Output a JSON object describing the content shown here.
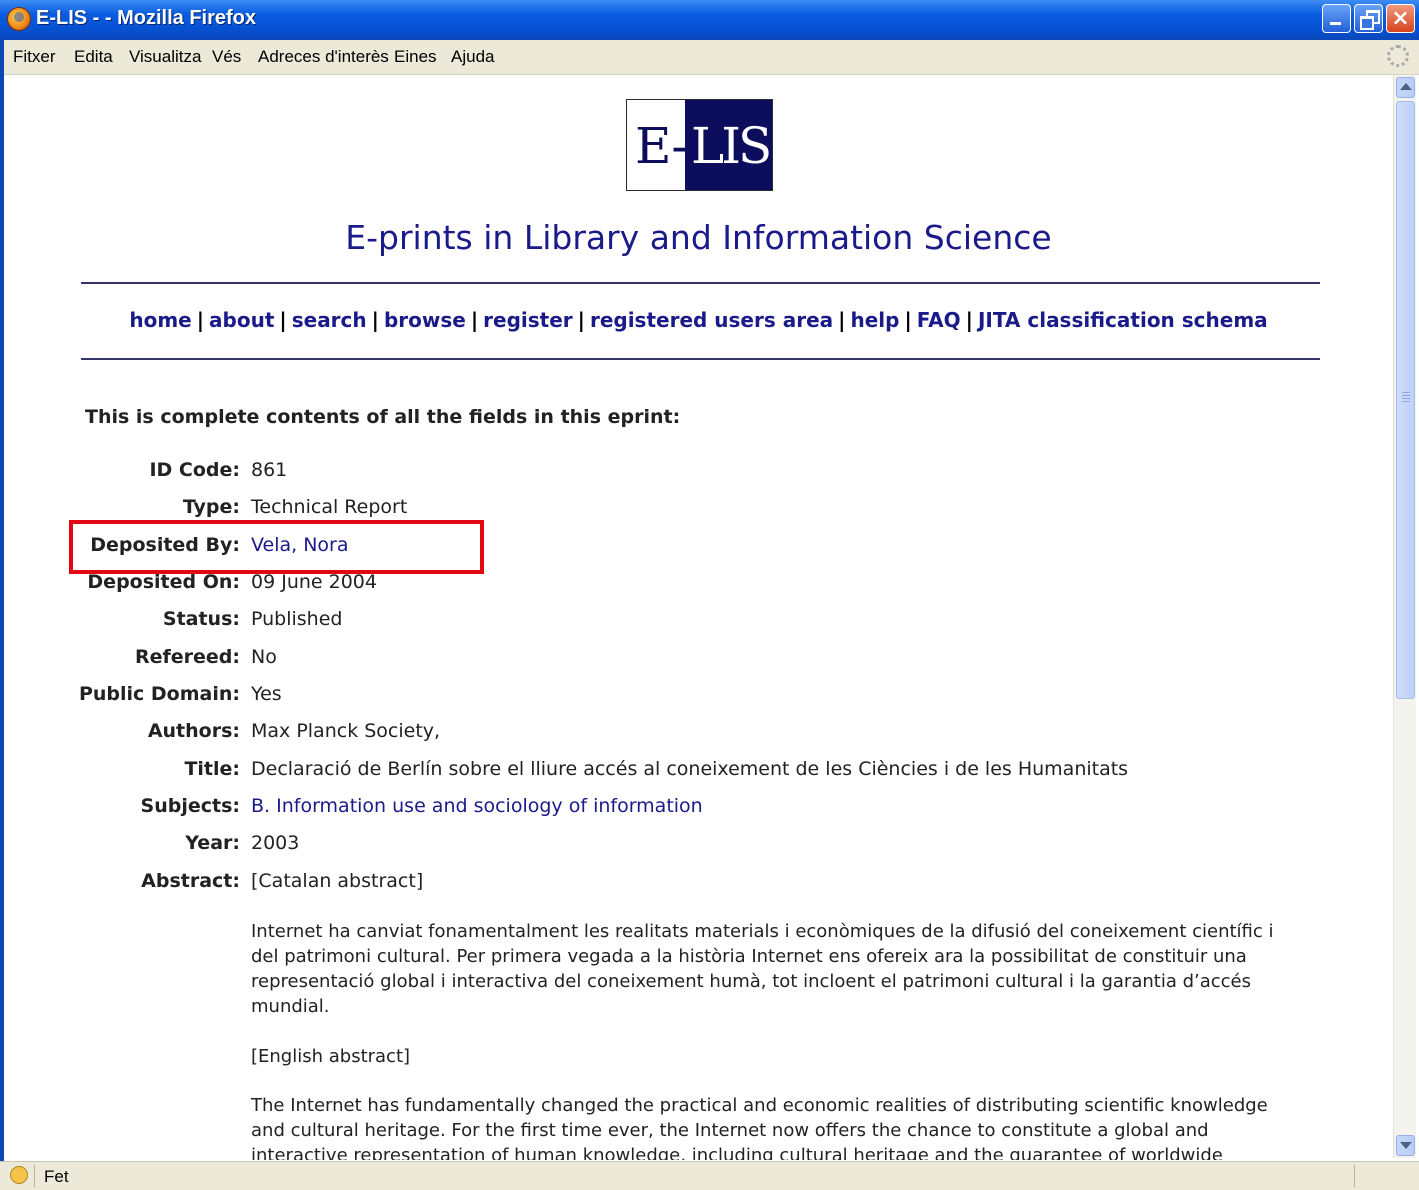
{
  "window": {
    "title": "E-LIS - - Mozilla Firefox",
    "controls": {
      "minimize": "minimize",
      "maximize": "maximize",
      "close": "×"
    }
  },
  "menu": [
    "Fitxer",
    "Edita",
    "Visualitza",
    "Vés",
    "Adreces d'interès",
    "Eines",
    "Ajuda"
  ],
  "page": {
    "logo": {
      "left_text": "E-",
      "right_text": "LIS"
    },
    "site_title": "E-prints in Library and Information Science",
    "nav": [
      "home",
      "about",
      "search",
      "browse",
      "register",
      "registered users area",
      "help",
      "FAQ",
      "JITA classification schema"
    ],
    "nav_separator": "|",
    "intro": "This is complete contents of all the fields in this eprint:",
    "fields": [
      {
        "label": "ID Code:",
        "value": "861"
      },
      {
        "label": "Type:",
        "value": "Technical Report"
      },
      {
        "label": "Deposited By:",
        "value": "Vela, Nora"
      },
      {
        "label": "Deposited On:",
        "value": "09 June 2004"
      },
      {
        "label": "Status:",
        "value": "Published"
      },
      {
        "label": "Refereed:",
        "value": "No"
      },
      {
        "label": "Public Domain:",
        "value": "Yes"
      },
      {
        "label": "Authors:",
        "value": "Max Planck Society,"
      },
      {
        "label": "Title:",
        "value": "Declaració de Berlín sobre el lliure accés al coneixement de les Ciències i de les Humanitats"
      },
      {
        "label": "Subjects:",
        "value": "B. Information use and sociology of information"
      },
      {
        "label": "Year:",
        "value": "2003"
      },
      {
        "label": "Abstract:",
        "value": "[Catalan abstract]"
      }
    ],
    "abstract_catalan": "Internet ha canviat fonamentalment les realitats materials i econòmiques de la difusió del coneixement científic i del patrimoni cultural. Per primera vegada a la història Internet ens ofereix ara la possibilitat de constituir una representació global i interactiva del coneixement humà, tot incloent el patrimoni cultural i la garantia d’accés mundial.",
    "english_heading": "[English abstract]",
    "abstract_english": "The Internet has fundamentally changed the practical and economic realities of distributing scientific knowledge and cultural heritage. For the first time ever, the Internet now offers the chance to constitute a global and interactive representation of human knowledge, including cultural heritage and the guarantee of worldwide access."
  },
  "status": {
    "text": "Fet"
  },
  "colors": {
    "link": "#1a1a8a",
    "highlight": "#e30613",
    "titlebar": "#0652d4"
  }
}
